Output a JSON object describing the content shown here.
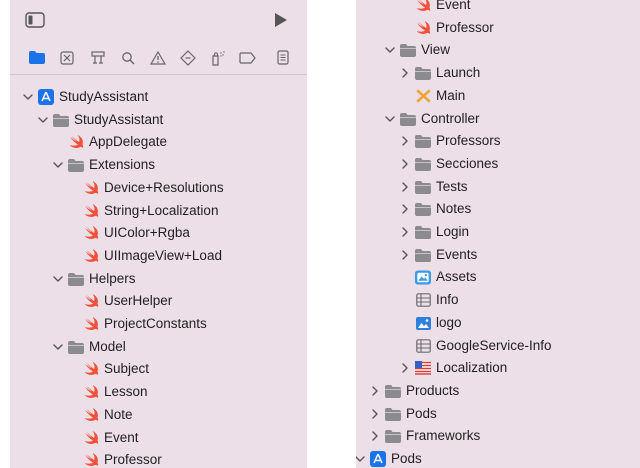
{
  "left_tree": [
    {
      "label": "StudyAssistant",
      "icon": "app-project-icon",
      "chevron": "down"
    },
    {
      "label": "StudyAssistant",
      "icon": "folder-icon",
      "chevron": "down"
    },
    {
      "label": "AppDelegate",
      "icon": "swift-file-icon",
      "chevron": ""
    },
    {
      "label": "Extensions",
      "icon": "folder-icon",
      "chevron": "down"
    },
    {
      "label": "Device+Resolutions",
      "icon": "swift-file-icon",
      "chevron": ""
    },
    {
      "label": "String+Localization",
      "icon": "swift-file-icon",
      "chevron": ""
    },
    {
      "label": "UIColor+Rgba",
      "icon": "swift-file-icon",
      "chevron": ""
    },
    {
      "label": "UIImageView+Load",
      "icon": "swift-file-icon",
      "chevron": ""
    },
    {
      "label": "Helpers",
      "icon": "folder-icon",
      "chevron": "down"
    },
    {
      "label": "UserHelper",
      "icon": "swift-file-icon",
      "chevron": ""
    },
    {
      "label": "ProjectConstants",
      "icon": "swift-file-icon",
      "chevron": ""
    },
    {
      "label": "Model",
      "icon": "folder-icon",
      "chevron": "down"
    },
    {
      "label": "Subject",
      "icon": "swift-file-icon",
      "chevron": ""
    },
    {
      "label": "Lesson",
      "icon": "swift-file-icon",
      "chevron": ""
    },
    {
      "label": "Note",
      "icon": "swift-file-icon",
      "chevron": ""
    },
    {
      "label": "Event",
      "icon": "swift-file-icon",
      "chevron": ""
    },
    {
      "label": "Professor",
      "icon": "swift-file-icon",
      "chevron": ""
    }
  ],
  "right_tree": [
    {
      "label": "Event",
      "icon": "swift-file-icon",
      "chevron": ""
    },
    {
      "label": "Professor",
      "icon": "swift-file-icon",
      "chevron": ""
    },
    {
      "label": "View",
      "icon": "folder-icon",
      "chevron": "down"
    },
    {
      "label": "Launch",
      "icon": "folder-icon",
      "chevron": "right"
    },
    {
      "label": "Main",
      "icon": "storyboard-icon",
      "chevron": ""
    },
    {
      "label": "Controller",
      "icon": "folder-icon",
      "chevron": "down"
    },
    {
      "label": "Professors",
      "icon": "folder-icon",
      "chevron": "right"
    },
    {
      "label": "Secciones",
      "icon": "folder-icon",
      "chevron": "right"
    },
    {
      "label": "Tests",
      "icon": "folder-icon",
      "chevron": "right"
    },
    {
      "label": "Notes",
      "icon": "folder-icon",
      "chevron": "right"
    },
    {
      "label": "Login",
      "icon": "folder-icon",
      "chevron": "right"
    },
    {
      "label": "Events",
      "icon": "folder-icon",
      "chevron": "right"
    },
    {
      "label": "Assets",
      "icon": "assets-icon",
      "chevron": ""
    },
    {
      "label": "Info",
      "icon": "plist-icon",
      "chevron": ""
    },
    {
      "label": "logo",
      "icon": "image-icon",
      "chevron": ""
    },
    {
      "label": "GoogleService-Info",
      "icon": "plist-icon",
      "chevron": ""
    },
    {
      "label": "Localization",
      "icon": "strings-file-icon",
      "chevron": "right"
    },
    {
      "label": "Products",
      "icon": "folder-icon",
      "chevron": "right"
    },
    {
      "label": "Pods",
      "icon": "folder-icon",
      "chevron": "right"
    },
    {
      "label": "Frameworks",
      "icon": "folder-icon",
      "chevron": "right"
    },
    {
      "label": "Pods",
      "icon": "app-project-icon",
      "chevron": "down"
    }
  ],
  "colors": {
    "panel_bg": "#eddfe7",
    "accent": "#1a73e8",
    "swift": "#f05138",
    "folder": "#8a8a8f"
  }
}
